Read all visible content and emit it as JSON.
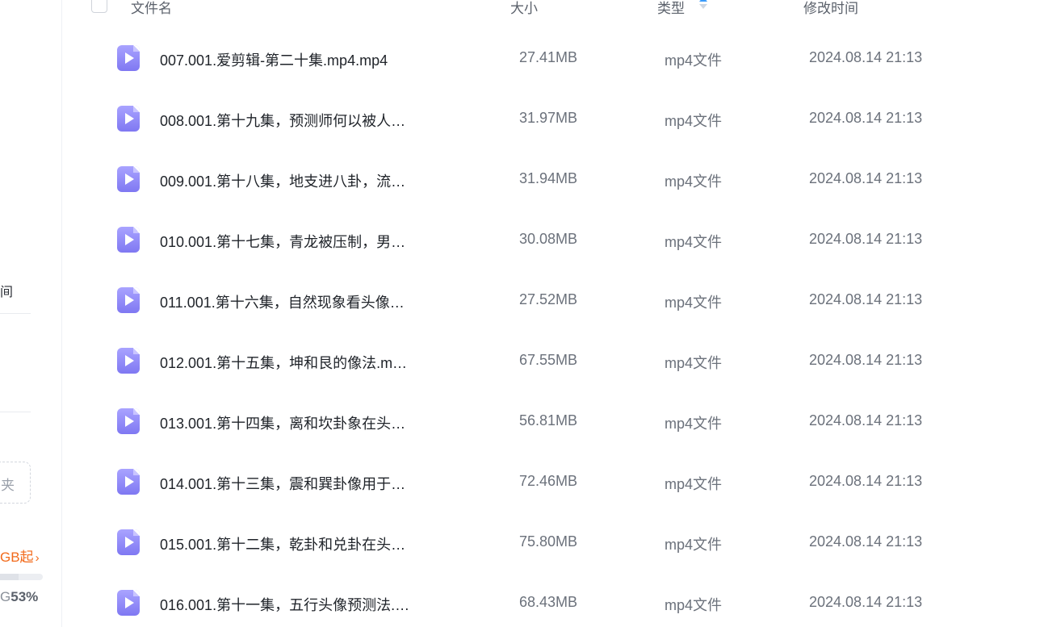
{
  "sidebar": {
    "recent_label_fragment": "间",
    "new_folder_fragment": "夹",
    "upgrade_text": "GB起",
    "upgrade_chevron": "›",
    "storage_prefix": "G",
    "storage_percent": "53%",
    "storage_fill_fraction": 0.53
  },
  "header": {
    "name": "文件名",
    "size": "大小",
    "type": "类型",
    "modified": "修改时间"
  },
  "files": [
    {
      "name": "007.001.爱剪辑-第二十集.mp4.mp4",
      "size": "27.41MB",
      "type": "mp4文件",
      "modified": "2024.08.14 21:13"
    },
    {
      "name": "008.001.第十九集，预测师何以被人…",
      "size": "31.97MB",
      "type": "mp4文件",
      "modified": "2024.08.14 21:13"
    },
    {
      "name": "009.001.第十八集，地支进八卦，流…",
      "size": "31.94MB",
      "type": "mp4文件",
      "modified": "2024.08.14 21:13"
    },
    {
      "name": "010.001.第十七集，青龙被压制，男…",
      "size": "30.08MB",
      "type": "mp4文件",
      "modified": "2024.08.14 21:13"
    },
    {
      "name": "011.001.第十六集，自然现象看头像…",
      "size": "27.52MB",
      "type": "mp4文件",
      "modified": "2024.08.14 21:13"
    },
    {
      "name": "012.001.第十五集，坤和艮的像法.m…",
      "size": "67.55MB",
      "type": "mp4文件",
      "modified": "2024.08.14 21:13"
    },
    {
      "name": "013.001.第十四集，离和坎卦象在头…",
      "size": "56.81MB",
      "type": "mp4文件",
      "modified": "2024.08.14 21:13"
    },
    {
      "name": "014.001.第十三集，震和巽卦像用于…",
      "size": "72.46MB",
      "type": "mp4文件",
      "modified": "2024.08.14 21:13"
    },
    {
      "name": "015.001.第十二集，乾卦和兑卦在头…",
      "size": "75.80MB",
      "type": "mp4文件",
      "modified": "2024.08.14 21:13"
    },
    {
      "name": "016.001.第十一集，五行头像预测法.…",
      "size": "68.43MB",
      "type": "mp4文件",
      "modified": "2024.08.14 21:13"
    }
  ]
}
